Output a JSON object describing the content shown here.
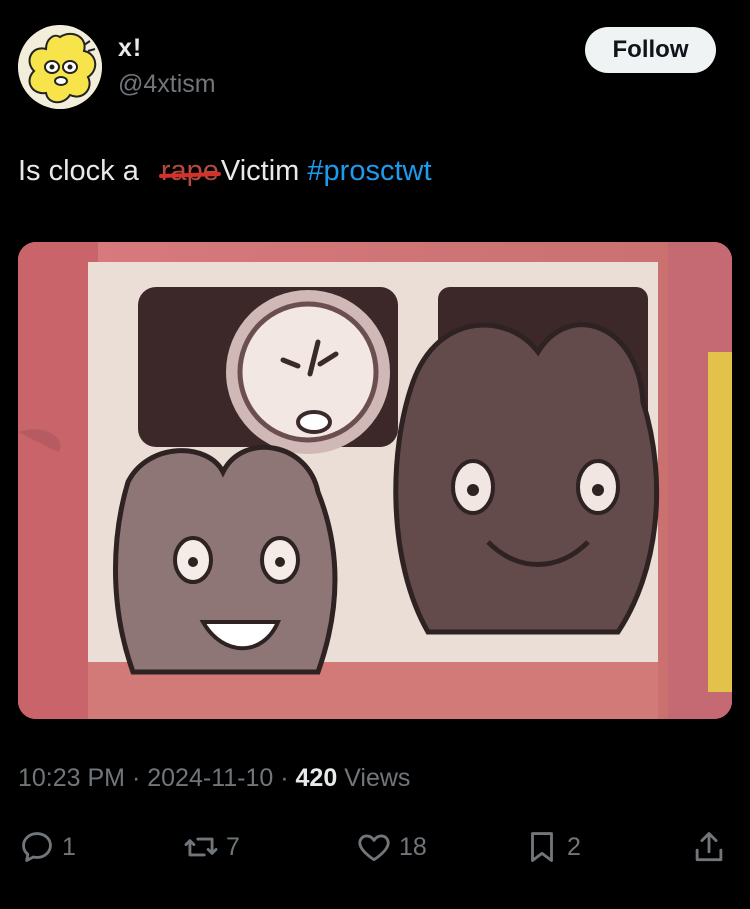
{
  "author": {
    "display_name": "x!",
    "handle": "@4xtism",
    "avatar_icon": "four-character-avatar"
  },
  "follow_label": "Follow",
  "tweet": {
    "text_before": "Is clock a",
    "struck_word": "rape",
    "text_after": "Victim",
    "hashtag": "#prosctwt"
  },
  "media": {
    "alt": "attached-image"
  },
  "meta": {
    "time": "10:23 PM",
    "sep1": "·",
    "date": "2024-11-10",
    "sep2": "·",
    "views_count": "420",
    "views_label": "Views"
  },
  "actions": {
    "replies": "1",
    "reposts": "7",
    "likes": "18",
    "bookmarks": "2"
  },
  "colors": {
    "background": "#000000",
    "accent": "#1d9bf0",
    "muted": "#71767b",
    "strike": "#d6302a"
  }
}
